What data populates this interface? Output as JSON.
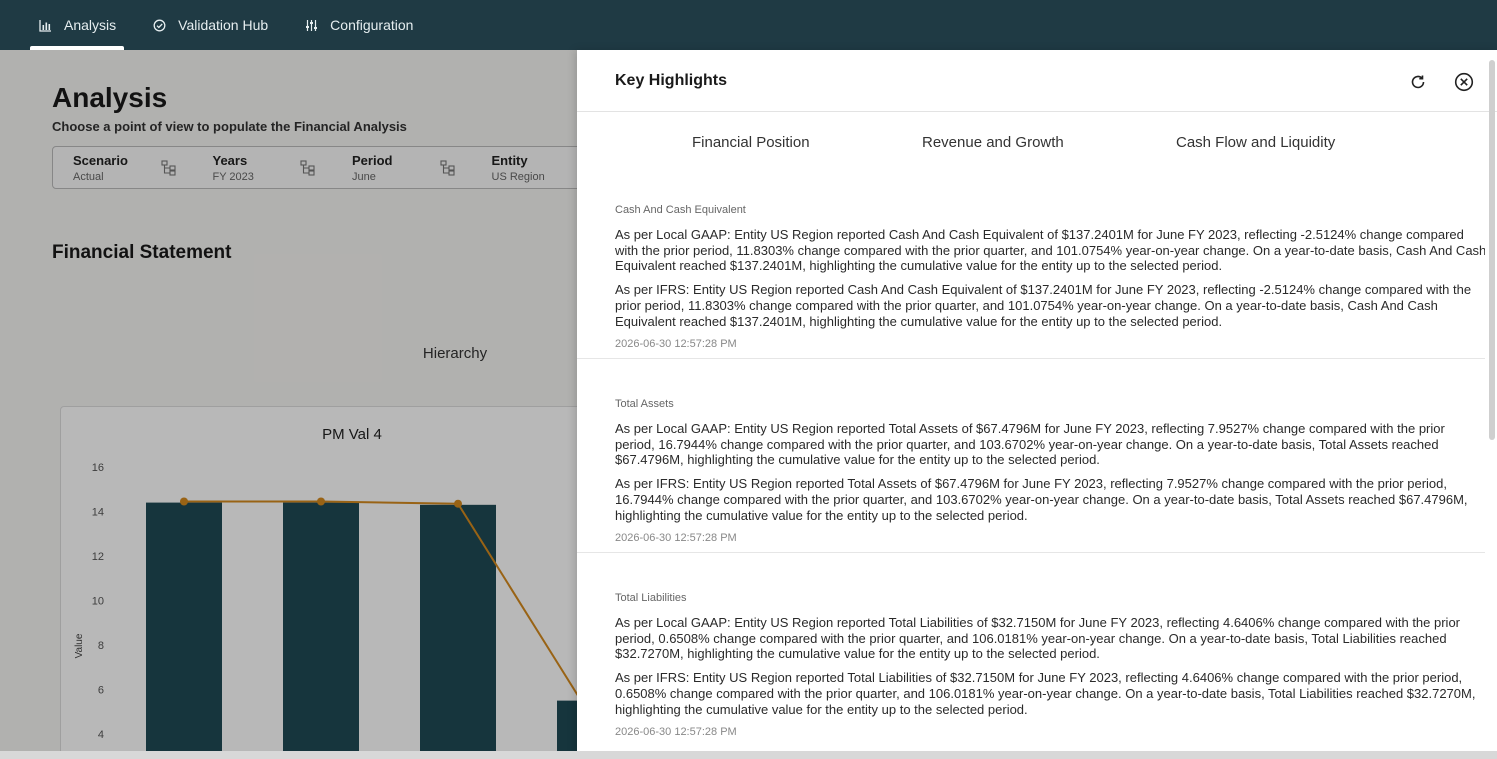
{
  "nav": {
    "tabs": [
      {
        "label": "Analysis",
        "icon": "bar-chart-icon",
        "active": true
      },
      {
        "label": "Validation Hub",
        "icon": "check-circle-icon",
        "active": false
      },
      {
        "label": "Configuration",
        "icon": "sliders-icon",
        "active": false
      }
    ]
  },
  "analysis": {
    "title": "Analysis",
    "subtitle": "Choose a point of view to populate the Financial Analysis",
    "pov": [
      {
        "label": "Scenario",
        "value": "Actual"
      },
      {
        "label": "Years",
        "value": "FY 2023"
      },
      {
        "label": "Period",
        "value": "June"
      },
      {
        "label": "Entity",
        "value": "US Region"
      }
    ],
    "statement_title": "Financial Statement",
    "hierarchy_label": "Hierarchy"
  },
  "chart_data": {
    "type": "bar",
    "title": "PM Val 4",
    "ylabel": "Value",
    "ylim": [
      4,
      16
    ],
    "yticks": [
      4,
      6,
      8,
      10,
      12,
      14,
      16
    ],
    "bar_values": [
      14.4,
      14.4,
      14.3,
      5.5
    ],
    "line_values": [
      14.45,
      14.45,
      14.35,
      4.5
    ],
    "colors": {
      "bar": "#1f4a55",
      "line": "#d48a1e"
    }
  },
  "panel": {
    "title": "Key Highlights",
    "tabs": [
      "Financial Position",
      "Revenue and Growth",
      "Cash Flow and Liquidity"
    ],
    "sections": [
      {
        "title": "Cash And Cash Equivalent",
        "paragraphs": [
          "As per Local GAAP: Entity US Region reported Cash And Cash Equivalent of $137.2401M for June FY 2023, reflecting -2.5124% change compared with the prior period, 11.8303% change compared with the prior quarter, and 101.0754% year-on-year change. On a year-to-date basis, Cash And Cash Equivalent reached $137.2401M, highlighting the cumulative value for the entity up to the selected period.",
          "As per IFRS: Entity US Region reported Cash And Cash Equivalent of $137.2401M for June FY 2023, reflecting -2.5124% change compared with the prior period, 11.8303% change compared with the prior quarter, and 101.0754% year-on-year change. On a year-to-date basis, Cash And Cash Equivalent reached $137.2401M, highlighting the cumulative value for the entity up to the selected period."
        ],
        "timestamp": "2026-06-30 12:57:28 PM"
      },
      {
        "title": "Total Assets",
        "paragraphs": [
          "As per Local GAAP: Entity US Region reported Total Assets of $67.4796M for June FY 2023, reflecting 7.9527% change compared with the prior period, 16.7944% change compared with the prior quarter, and 103.6702% year-on-year change. On a year-to-date basis, Total Assets reached $67.4796M, highlighting the cumulative value for the entity up to the selected period.",
          "As per IFRS: Entity US Region reported Total Assets of $67.4796M for June FY 2023, reflecting 7.9527% change compared with the prior period, 16.7944% change compared with the prior quarter, and 103.6702% year-on-year change. On a year-to-date basis, Total Assets reached $67.4796M, highlighting the cumulative value for the entity up to the selected period."
        ],
        "timestamp": "2026-06-30 12:57:28 PM"
      },
      {
        "title": "Total Liabilities",
        "paragraphs": [
          "As per Local GAAP: Entity US Region reported Total Liabilities of $32.7150M for June FY 2023, reflecting 4.6406% change compared with the prior period, 0.6508% change compared with the prior quarter, and 106.0181% year-on-year change. On a year-to-date basis, Total Liabilities reached $32.7270M, highlighting the cumulative value for the entity up to the selected period.",
          "As per IFRS: Entity US Region reported Total Liabilities of $32.7150M for June FY 2023, reflecting 4.6406% change compared with the prior period, 0.6508% change compared with the prior quarter, and 106.0181% year-on-year change. On a year-to-date basis, Total Liabilities reached $32.7270M, highlighting the cumulative value for the entity up to the selected period."
        ],
        "timestamp": "2026-06-30 12:57:28 PM"
      }
    ]
  }
}
